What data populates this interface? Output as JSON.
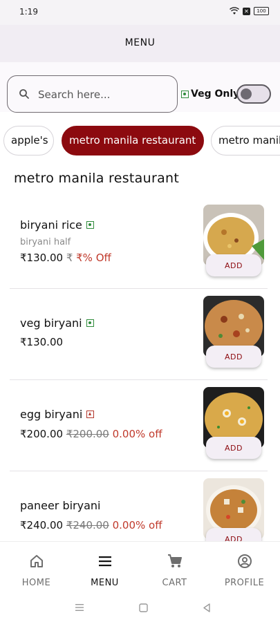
{
  "status": {
    "time": "1:19",
    "battery": "100"
  },
  "header": {
    "title": "MENU"
  },
  "search": {
    "placeholder": "Search here...",
    "value": ""
  },
  "veg_only": {
    "label": "Veg Only",
    "enabled": false
  },
  "categories": [
    {
      "label": "apple's",
      "active": false
    },
    {
      "label": "metro manila restaurant",
      "active": true
    },
    {
      "label": "metro manila",
      "active": false
    }
  ],
  "section_title": "metro manila restaurant",
  "items": [
    {
      "name": "biryani rice",
      "type": "veg",
      "description": "biryani half",
      "price": "₹130.00",
      "old_price": "₹",
      "discount": "₹% Off",
      "add_label": "ADD",
      "image": "food-photo"
    },
    {
      "name": "veg biryani",
      "type": "veg",
      "description": "",
      "price": "₹130.00",
      "old_price": "",
      "discount": "",
      "add_label": "ADD",
      "image": "food-photo"
    },
    {
      "name": "egg biryani",
      "type": "non-veg",
      "description": "",
      "price": "₹200.00",
      "old_price": "₹200.00",
      "discount": "0.00% off",
      "add_label": "ADD",
      "image": "food-photo"
    },
    {
      "name": "paneer biryani",
      "type": "veg",
      "description": "",
      "price": "₹240.00",
      "old_price": "₹240.00",
      "discount": "0.00% off",
      "add_label": "ADD",
      "image": "food-photo"
    }
  ],
  "bottom_nav": [
    {
      "label": "HOME",
      "icon": "home-icon",
      "active": false
    },
    {
      "label": "MENU",
      "icon": "menu-icon",
      "active": true
    },
    {
      "label": "CART",
      "icon": "cart-icon",
      "active": false
    },
    {
      "label": "PROFILE",
      "icon": "profile-icon",
      "active": false
    }
  ],
  "colors": {
    "accent": "#8c0a0f",
    "veg": "#2e8b3a",
    "nonveg": "#b3362b",
    "discount": "#c0392b",
    "header_bg": "#f1edf3"
  }
}
